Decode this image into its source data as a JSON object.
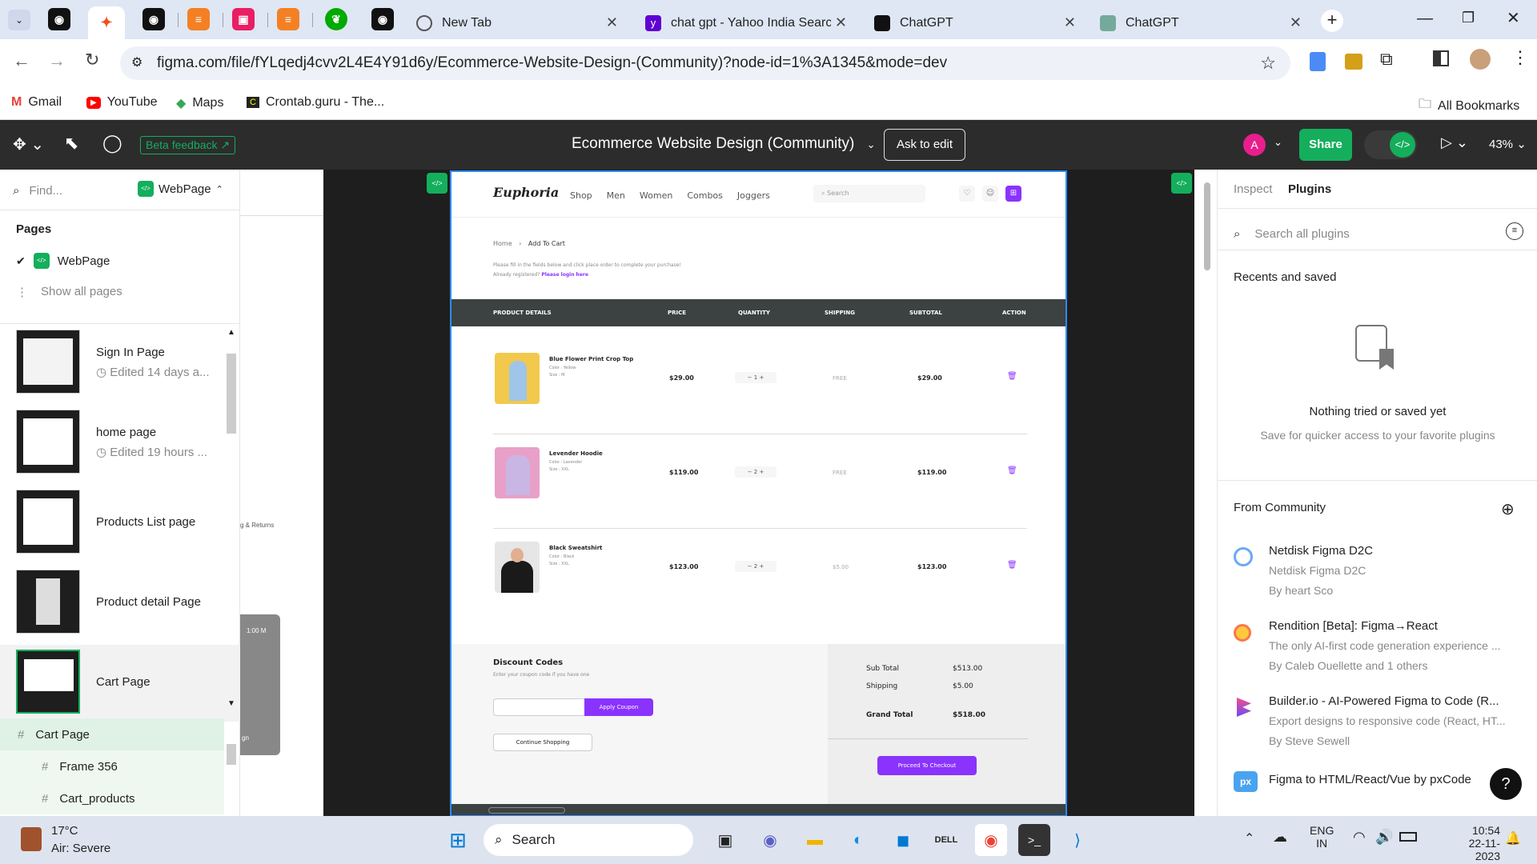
{
  "browser": {
    "tabs": [
      {
        "label": "New Tab"
      },
      {
        "label": "chat gpt - Yahoo India Searc"
      },
      {
        "label": "ChatGPT"
      },
      {
        "label": "ChatGPT"
      }
    ],
    "url": "figma.com/file/fYLqedj4cvv2L4E4Y91d6y/Ecommerce-Website-Design-(Community)?node-id=1%3A1345&mode=dev",
    "bookmarks": [
      "Gmail",
      "YouTube",
      "Maps",
      "Crontab.guru - The...",
      "All Bookmarks"
    ]
  },
  "figma": {
    "beta_feedback": "Beta feedback",
    "file_title": "Ecommerce Website Design (Community)",
    "ask_to_edit": "Ask to edit",
    "avatar_letter": "A",
    "share": "Share",
    "zoom": "43%"
  },
  "left_panel": {
    "find_placeholder": "Find...",
    "page_selector": "WebPage",
    "pages_heading": "Pages",
    "current_page": "WebPage",
    "show_all_pages": "Show all pages",
    "frames": [
      {
        "title": "Sign In Page",
        "meta": "Edited 14 days a..."
      },
      {
        "title": "home page",
        "meta": "Edited 19 hours ..."
      },
      {
        "title": "Products List page",
        "meta": ""
      },
      {
        "title": "Product detail Page",
        "meta": ""
      },
      {
        "title": "Cart Page",
        "meta": ""
      }
    ],
    "layers": [
      "Cart Page",
      "Frame 356",
      "Cart_products"
    ]
  },
  "canvas": {
    "side_text": "g & Returns",
    "side_label": "1:00 M",
    "side_bottom": "gn"
  },
  "design": {
    "logo": "Euphoria",
    "nav": [
      "Shop",
      "Men",
      "Women",
      "Combos",
      "Joggers"
    ],
    "search_placeholder": "Search",
    "breadcrumb_home": "Home",
    "breadcrumb_current": "Add To Cart",
    "info_line1": "Please fill in the fields below and click place order to complete your purchase!",
    "info_line2_prefix": "Already registered?",
    "info_line2_link": "Please login here",
    "table_headers": [
      "PRODUCT DETAILS",
      "PRICE",
      "QUANTITY",
      "SHIPPING",
      "SUBTOTAL",
      "ACTION"
    ],
    "items": [
      {
        "name": "Blue Flower Print Crop Top",
        "color": "Color : Yellow",
        "size": "Size : M",
        "price": "$29.00",
        "qty": "1",
        "shipping": "FREE",
        "subtotal": "$29.00"
      },
      {
        "name": "Levender Hoodie",
        "color": "Color : Lavender",
        "size": "Size : XXL",
        "price": "$119.00",
        "qty": "2",
        "shipping": "FREE",
        "subtotal": "$119.00"
      },
      {
        "name": "Black Sweatshirt",
        "color": "Color : Black",
        "size": "Size : XXL",
        "price": "$123.00",
        "qty": "2",
        "shipping": "$5.00",
        "subtotal": "$123.00"
      }
    ],
    "discount_title": "Discount  Codes",
    "discount_sub": "Enter your coupon code if you have one",
    "apply_coupon": "Apply Coupon",
    "continue_shopping": "Continue Shopping",
    "sub_total_label": "Sub Total",
    "sub_total": "$513.00",
    "shipping_label": "Shipping",
    "shipping_total": "$5.00",
    "grand_total_label": "Grand Total",
    "grand_total": "$518.00",
    "checkout": "Proceed To Checkout"
  },
  "right_panel": {
    "tabs": [
      "Inspect",
      "Plugins"
    ],
    "search_placeholder": "Search all plugins",
    "recents_heading": "Recents and saved",
    "empty_title": "Nothing tried or saved yet",
    "empty_sub": "Save for quicker access to your favorite plugins",
    "community_heading": "From Community",
    "plugins": [
      {
        "name": "Netdisk Figma D2C",
        "desc": "Netdisk Figma D2C",
        "by": "By heart Sco"
      },
      {
        "name": "Rendition [Beta]: Figma→React",
        "desc": "The only AI-first code generation experience ...",
        "by": "By Caleb Ouellette and 1 others"
      },
      {
        "name": "Builder.io - AI-Powered Figma to Code (R...",
        "desc": "Export designs to responsive code (React, HT...",
        "by": "By Steve Sewell"
      },
      {
        "name": "Figma to HTML/React/Vue by pxCode",
        "desc": "",
        "by": ""
      }
    ]
  },
  "taskbar": {
    "weather_temp": "17°C",
    "weather_desc": "Air: Severe",
    "search": "Search",
    "lang1": "ENG",
    "lang2": "IN",
    "time": "10:54",
    "date": "22-11-2023"
  },
  "colors": {
    "accent_purple": "#8a33fd",
    "figma_green": "#14ae5c",
    "selection_blue": "#2d8cff"
  }
}
